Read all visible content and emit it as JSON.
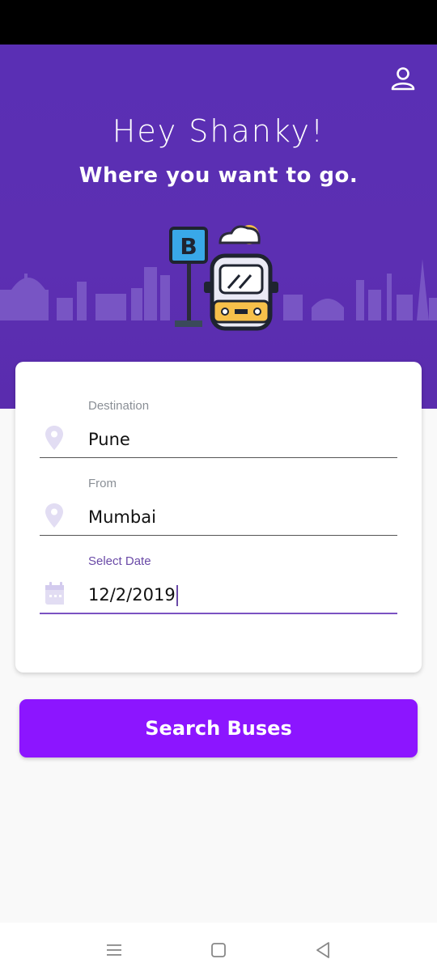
{
  "header": {
    "greeting": "Hey Shanky!",
    "subtitle": "Where you want to go.",
    "profile_icon": "person-icon",
    "bus_stop_sign": "B"
  },
  "form": {
    "destination": {
      "label": "Destination",
      "value": "Pune",
      "icon": "location-pin-icon"
    },
    "from": {
      "label": "From",
      "value": "Mumbai",
      "icon": "location-pin-icon"
    },
    "date": {
      "label": "Select Date",
      "value": "12/2/2019",
      "icon": "calendar-icon"
    }
  },
  "search_button": {
    "label": "Search Buses"
  },
  "nav": {
    "menu": "menu-icon",
    "home": "home-square-icon",
    "back": "back-triangle-icon"
  },
  "colors": {
    "header_bg": "#5c2fb2",
    "button_bg": "#8c15ff",
    "accent": "#7b52c2"
  }
}
